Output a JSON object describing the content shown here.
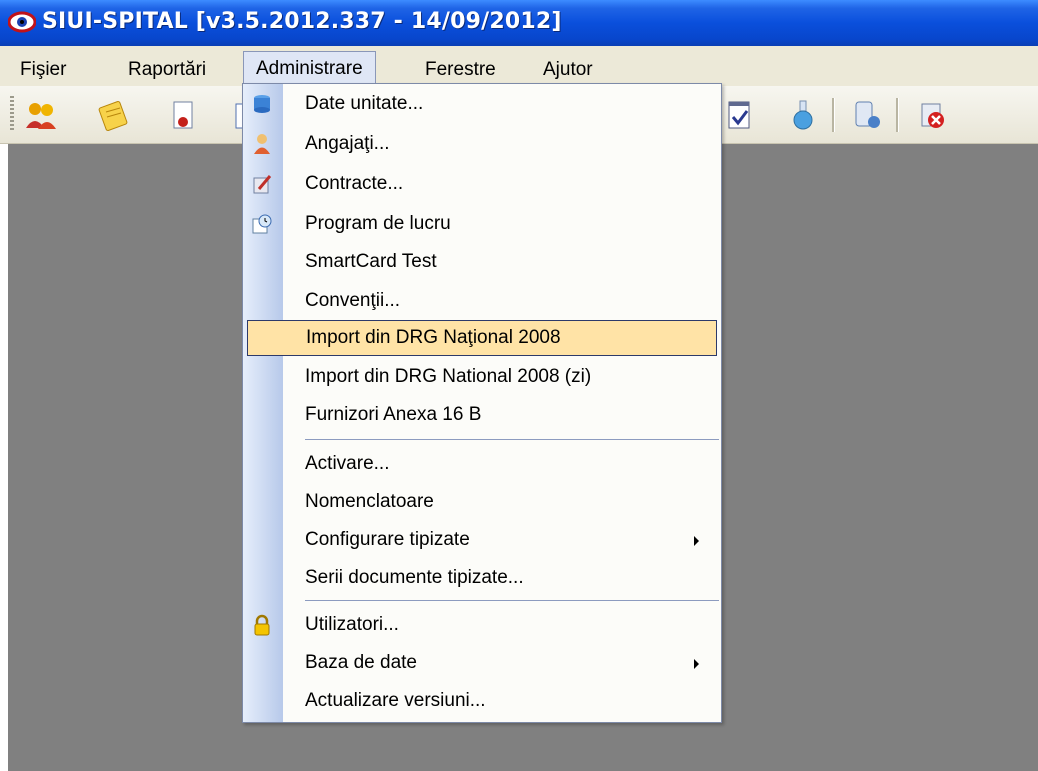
{
  "window": {
    "title": "SIUI-SPITAL [v3.5.2012.337 - 14/09/2012]",
    "app_icon": "eye-icon"
  },
  "menubar": {
    "items": [
      {
        "label": "Fişier"
      },
      {
        "label": "Raportări"
      },
      {
        "label": "Administrare",
        "active": true
      },
      {
        "label": "Ferestre"
      },
      {
        "label": "Ajutor"
      }
    ]
  },
  "toolbar": {
    "icons": [
      "users-icon",
      "notes-icon",
      "document-certificate-icon",
      "import-icon",
      "report-check-icon",
      "lab-flask-icon",
      "database-user-icon",
      "exit-icon"
    ]
  },
  "dropdown": {
    "items": [
      {
        "label": "Date unitate...",
        "icon": "database-icon"
      },
      {
        "label": "Angajaţi...",
        "icon": "employee-icon"
      },
      {
        "label": "Contracte...",
        "icon": "contract-edit-icon"
      },
      {
        "label": "Program de lucru",
        "icon": "schedule-clock-icon"
      },
      {
        "label": "SmartCard Test"
      },
      {
        "label": "Convenţii..."
      },
      {
        "label": "Import din DRG Naţional 2008",
        "highlighted": true
      },
      {
        "label": "Import din DRG National 2008 (zi)"
      },
      {
        "label": "Furnizori Anexa 16 B"
      },
      {
        "label": "Activare..."
      },
      {
        "label": "Nomenclatoare"
      },
      {
        "label": "Configurare tipizate",
        "submenu": true
      },
      {
        "label": "Serii documente tipizate..."
      },
      {
        "label": "Utilizatori...",
        "icon": "padlock-icon"
      },
      {
        "label": "Baza de date",
        "submenu": true
      },
      {
        "label": "Actualizare versiuni..."
      }
    ]
  },
  "colors": {
    "titlebar": "#0a4fdc",
    "menubar": "#ece9d8",
    "workspace": "#808080",
    "highlight": "#ffe3a6"
  }
}
